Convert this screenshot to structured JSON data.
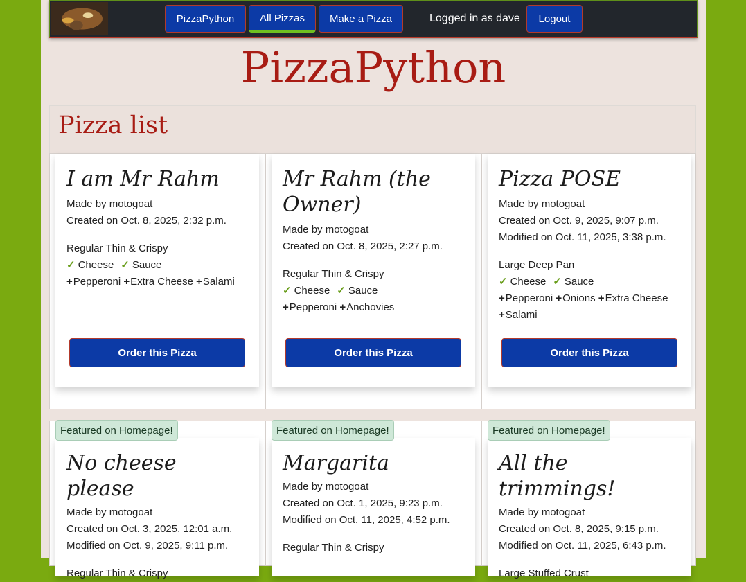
{
  "navbar": {
    "brand": "PizzaPython",
    "all_pizzas": "All Pizzas",
    "make_pizza": "Make a Pizza",
    "logged_in": "Logged in as dave",
    "logout": "Logout"
  },
  "site_title": "PizzaPython",
  "panel_title": "Pizza list",
  "order_label": "Order this Pizza",
  "featured_label": "Featured on Homepage!",
  "pizzas": [
    {
      "name": "I am Mr Rahm",
      "made_by": "Made by motogoat",
      "created": "Created on Oct. 8, 2025, 2:32 p.m.",
      "size": "Regular Thin & Crispy",
      "base_toppings": [
        "Cheese",
        "Sauce"
      ],
      "extras": [
        "Pepperoni",
        "Extra Cheese",
        "Salami"
      ]
    },
    {
      "name": "Mr Rahm (the Owner)",
      "made_by": "Made by motogoat",
      "created": "Created on Oct. 8, 2025, 2:27 p.m.",
      "size": "Regular Thin & Crispy",
      "base_toppings": [
        "Cheese",
        "Sauce"
      ],
      "extras": [
        "Pepperoni",
        "Anchovies"
      ]
    },
    {
      "name": "Pizza POSE",
      "made_by": "Made by motogoat",
      "created": "Created on Oct. 9, 2025, 9:07 p.m.",
      "modified": "Modified on Oct. 11, 2025, 3:38 p.m.",
      "size": "Large Deep Pan",
      "base_toppings": [
        "Cheese",
        "Sauce"
      ],
      "extras": [
        "Pepperoni",
        "Onions",
        "Extra Cheese",
        "Salami"
      ]
    },
    {
      "name": "No cheese please",
      "made_by": "Made by motogoat",
      "created": "Created on Oct. 3, 2025, 12:01 a.m.",
      "modified": "Modified on Oct. 9, 2025, 9:11 p.m.",
      "size": "Regular Thin & Crispy"
    },
    {
      "name": "Margarita",
      "made_by": "Made by motogoat",
      "created": "Created on Oct. 1, 2025, 9:23 p.m.",
      "modified": "Modified on Oct. 11, 2025, 4:52 p.m.",
      "size": "Regular Thin & Crispy"
    },
    {
      "name": "All the trimmings!",
      "made_by": "Made by motogoat",
      "created": "Created on Oct. 8, 2025, 9:15 p.m.",
      "modified": "Modified on Oct. 11, 2025, 6:43 p.m.",
      "size": "Large Stuffed Crust"
    }
  ]
}
